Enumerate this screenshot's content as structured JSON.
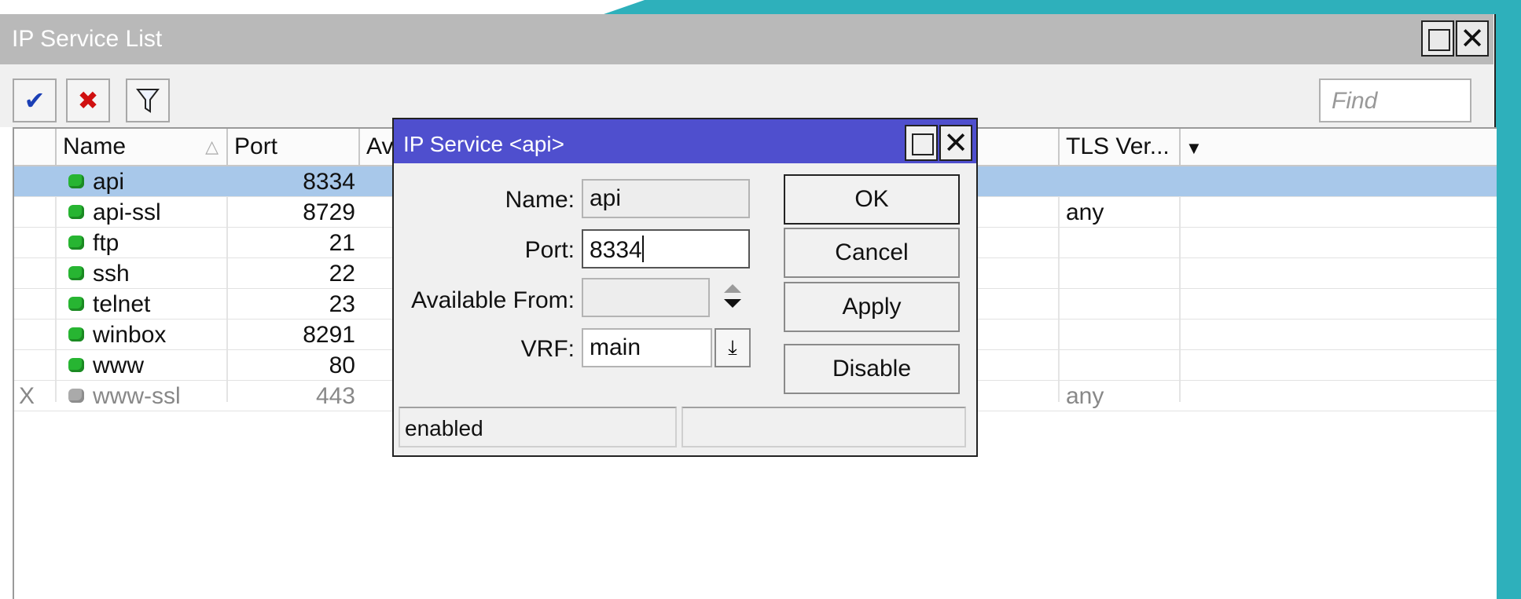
{
  "window": {
    "title": "IP Service List",
    "toolbar": {
      "enable_icon": "✔",
      "disable_icon": "✖",
      "filter_icon": "filter-icon"
    },
    "find_placeholder": "Find"
  },
  "table": {
    "columns": [
      "Name",
      "Port",
      "Av",
      "TLS Ver..."
    ],
    "rows": [
      {
        "flag": "",
        "name": "api",
        "port": "8334",
        "tls": ""
      },
      {
        "flag": "",
        "name": "api-ssl",
        "port": "8729",
        "tls": "any"
      },
      {
        "flag": "",
        "name": "ftp",
        "port": "21",
        "tls": ""
      },
      {
        "flag": "",
        "name": "ssh",
        "port": "22",
        "tls": ""
      },
      {
        "flag": "",
        "name": "telnet",
        "port": "23",
        "tls": ""
      },
      {
        "flag": "",
        "name": "winbox",
        "port": "8291",
        "tls": ""
      },
      {
        "flag": "",
        "name": "www",
        "port": "80",
        "tls": ""
      },
      {
        "flag": "X",
        "name": "www-ssl",
        "port": "443",
        "tls": "any"
      }
    ]
  },
  "dialog": {
    "title": "IP Service <api>",
    "labels": {
      "name": "Name:",
      "port": "Port:",
      "available_from": "Available From:",
      "vrf": "VRF:"
    },
    "values": {
      "name": "api",
      "port": "8334",
      "available_from": "",
      "vrf": "main"
    },
    "buttons": {
      "ok": "OK",
      "cancel": "Cancel",
      "apply": "Apply",
      "disable": "Disable"
    },
    "status": "enabled",
    "colors": {
      "title_bar": "#4f4fce"
    }
  }
}
